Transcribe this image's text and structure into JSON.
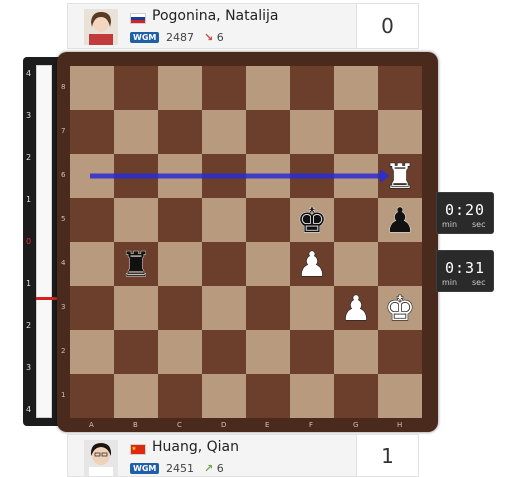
{
  "top_player": {
    "name": "Pogonina, Natalija",
    "title": "WGM",
    "rating": "2487",
    "rating_change": "6",
    "rating_trend": "down",
    "flag": "russia-flag",
    "score": "0",
    "avatar_icon": "player-photo-pogonina"
  },
  "bottom_player": {
    "name": "Huang, Qian",
    "title": "WGM",
    "rating": "2451",
    "rating_change": "6",
    "rating_trend": "up",
    "flag": "china-flag",
    "score": "1",
    "avatar_icon": "player-photo-huang"
  },
  "eval_bar": {
    "labels": [
      "4",
      "3",
      "2",
      "1",
      "0",
      "1",
      "2",
      "3",
      "4"
    ],
    "value": 0
  },
  "clocks": {
    "top": {
      "time": "0:20",
      "min_label": "min",
      "sec_label": "sec"
    },
    "bottom": {
      "time": "0:31",
      "min_label": "min",
      "sec_label": "sec"
    }
  },
  "board": {
    "files": [
      "A",
      "B",
      "C",
      "D",
      "E",
      "F",
      "G",
      "H"
    ],
    "ranks": [
      "8",
      "7",
      "6",
      "5",
      "4",
      "3",
      "2",
      "1"
    ],
    "light_square_color": "#b89a7e",
    "dark_square_color": "#6b3f2b",
    "arrow_color": "#2b2bd0",
    "pieces": [
      {
        "square": "h6",
        "type": "rook",
        "color": "white"
      },
      {
        "square": "f5",
        "type": "king",
        "color": "black"
      },
      {
        "square": "h5",
        "type": "pawn",
        "color": "black"
      },
      {
        "square": "b4",
        "type": "rook",
        "color": "black"
      },
      {
        "square": "f4",
        "type": "pawn",
        "color": "white"
      },
      {
        "square": "g3",
        "type": "pawn",
        "color": "white"
      },
      {
        "square": "h3",
        "type": "king",
        "color": "white"
      }
    ],
    "arrow": {
      "from": "a6",
      "to": "h6"
    }
  }
}
